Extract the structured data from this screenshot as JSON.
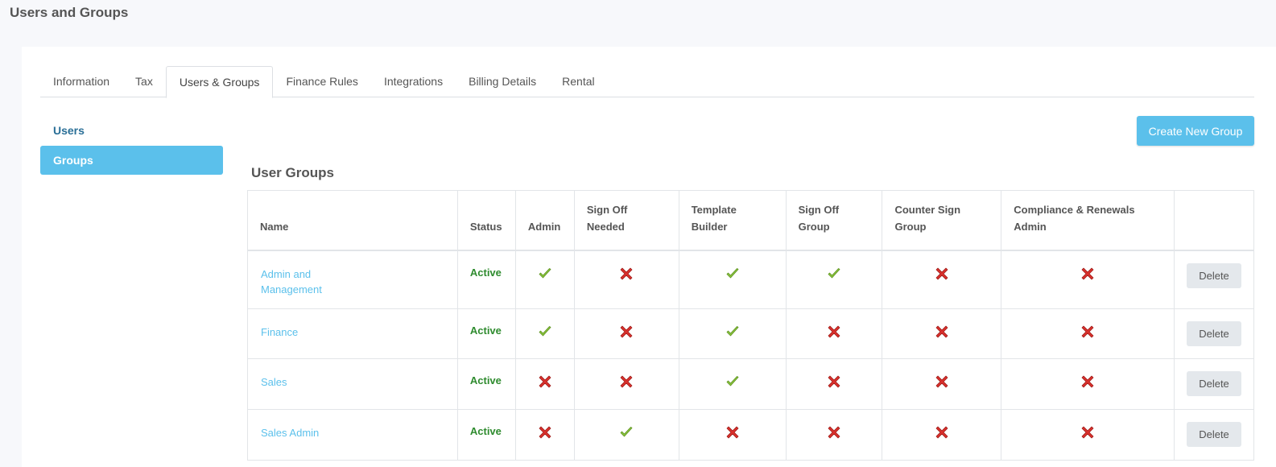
{
  "page": {
    "title": "Users and Groups"
  },
  "tabs": [
    {
      "label": "Information",
      "active": false
    },
    {
      "label": "Tax",
      "active": false
    },
    {
      "label": "Users & Groups",
      "active": true
    },
    {
      "label": "Finance Rules",
      "active": false
    },
    {
      "label": "Integrations",
      "active": false
    },
    {
      "label": "Billing Details",
      "active": false
    },
    {
      "label": "Rental",
      "active": false
    }
  ],
  "sidebar": {
    "items": [
      {
        "label": "Users",
        "active": false
      },
      {
        "label": "Groups",
        "active": true
      }
    ]
  },
  "toolbar": {
    "create_label": "Create New Group"
  },
  "groups_section": {
    "title": "User Groups"
  },
  "table": {
    "headers": {
      "name": "Name",
      "status": "Status",
      "admin": "Admin",
      "sign_off_needed": "Sign Off Needed",
      "template_builder": "Template Builder",
      "sign_off_group": "Sign Off Group",
      "counter_sign_group": "Counter Sign Group",
      "compliance_admin": "Compliance & Renewals Admin"
    },
    "delete_label": "Delete",
    "rows": [
      {
        "name": "Admin and Management",
        "status": "Active",
        "admin": true,
        "sign_off_needed": false,
        "template_builder": true,
        "sign_off_group": true,
        "counter_sign_group": false,
        "compliance_admin": false
      },
      {
        "name": "Finance",
        "status": "Active",
        "admin": true,
        "sign_off_needed": false,
        "template_builder": true,
        "sign_off_group": false,
        "counter_sign_group": false,
        "compliance_admin": false
      },
      {
        "name": "Sales",
        "status": "Active",
        "admin": false,
        "sign_off_needed": false,
        "template_builder": true,
        "sign_off_group": false,
        "counter_sign_group": false,
        "compliance_admin": false
      },
      {
        "name": "Sales Admin",
        "status": "Active",
        "admin": false,
        "sign_off_needed": true,
        "template_builder": false,
        "sign_off_group": false,
        "counter_sign_group": false,
        "compliance_admin": false
      }
    ]
  },
  "colors": {
    "accent": "#5bc0eb",
    "active_status": "#2e8b2e",
    "check": "#8cc63f",
    "cross": "#d9302c"
  },
  "icons": {
    "yes": "check-icon",
    "no": "cross-icon"
  }
}
